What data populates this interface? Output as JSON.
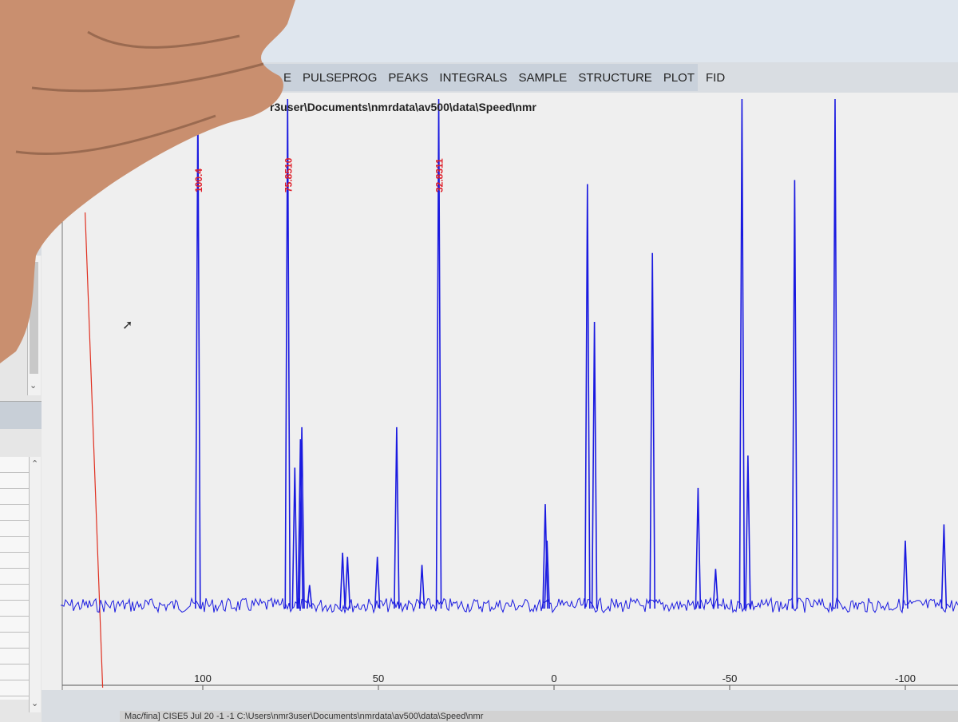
{
  "menu": {
    "items": [
      {
        "label": "E"
      },
      {
        "label": "PULSEPROG"
      },
      {
        "label": "PEAKS"
      },
      {
        "label": "INTEGRALS"
      },
      {
        "label": "SAMPLE"
      },
      {
        "label": "STRUCTURE"
      },
      {
        "label": "PLOT"
      },
      {
        "label": "FID"
      }
    ]
  },
  "spectrum": {
    "file_path": "r3user\\Documents\\nmrdata\\av500\\data\\Speed\\nmr",
    "x_ticks": [
      "100",
      "50",
      "0",
      "-50",
      "-100"
    ],
    "peak_labels": [
      "100.4",
      "75.8510",
      "32.8311"
    ]
  },
  "status": {
    "text": "Mac/fina] CISE5 Jul 20 -1 -1 C:\\Users\\nmr3user\\Documents\\nmrdata\\av500\\data\\Speed\\nmr"
  },
  "colors": {
    "spectrum_line": "#1a1ae0",
    "cursor_line": "#e03020",
    "peak_label": "#e0202a"
  },
  "chart_data": {
    "type": "line",
    "title": "",
    "xlabel": "",
    "ylabel": "",
    "xlim": [
      140,
      -115
    ],
    "x_ticks": [
      100,
      50,
      0,
      -50,
      -100
    ],
    "cursor_ppm": 128.5,
    "peak_labels": [
      {
        "ppm": 101.4,
        "text": "100.4"
      },
      {
        "ppm": 75.85,
        "text": "75.8510"
      },
      {
        "ppm": 32.83,
        "text": "32.8311"
      }
    ],
    "peaks": [
      {
        "ppm": 101.4,
        "height": 1.25
      },
      {
        "ppm": 75.85,
        "height": 1.25
      },
      {
        "ppm": 73.8,
        "height": 0.34
      },
      {
        "ppm": 72.2,
        "height": 0.41
      },
      {
        "ppm": 71.8,
        "height": 0.44
      },
      {
        "ppm": 69.6,
        "height": 0.05
      },
      {
        "ppm": 60.2,
        "height": 0.13
      },
      {
        "ppm": 58.8,
        "height": 0.12
      },
      {
        "ppm": 50.3,
        "height": 0.12
      },
      {
        "ppm": 44.8,
        "height": 0.44
      },
      {
        "ppm": 37.6,
        "height": 0.1
      },
      {
        "ppm": 32.83,
        "height": 1.25
      },
      {
        "ppm": 2.5,
        "height": 0.25
      },
      {
        "ppm": 2.0,
        "height": 0.16
      },
      {
        "ppm": -9.5,
        "height": 1.04
      },
      {
        "ppm": -11.5,
        "height": 0.7
      },
      {
        "ppm": -28.0,
        "height": 0.87
      },
      {
        "ppm": -41.0,
        "height": 0.29
      },
      {
        "ppm": -46.0,
        "height": 0.09
      },
      {
        "ppm": -53.5,
        "height": 1.25
      },
      {
        "ppm": -55.2,
        "height": 0.37
      },
      {
        "ppm": -68.5,
        "height": 1.05
      },
      {
        "ppm": -80.0,
        "height": 1.25
      },
      {
        "ppm": -100.0,
        "height": 0.16
      },
      {
        "ppm": -111.0,
        "height": 0.2
      }
    ]
  }
}
